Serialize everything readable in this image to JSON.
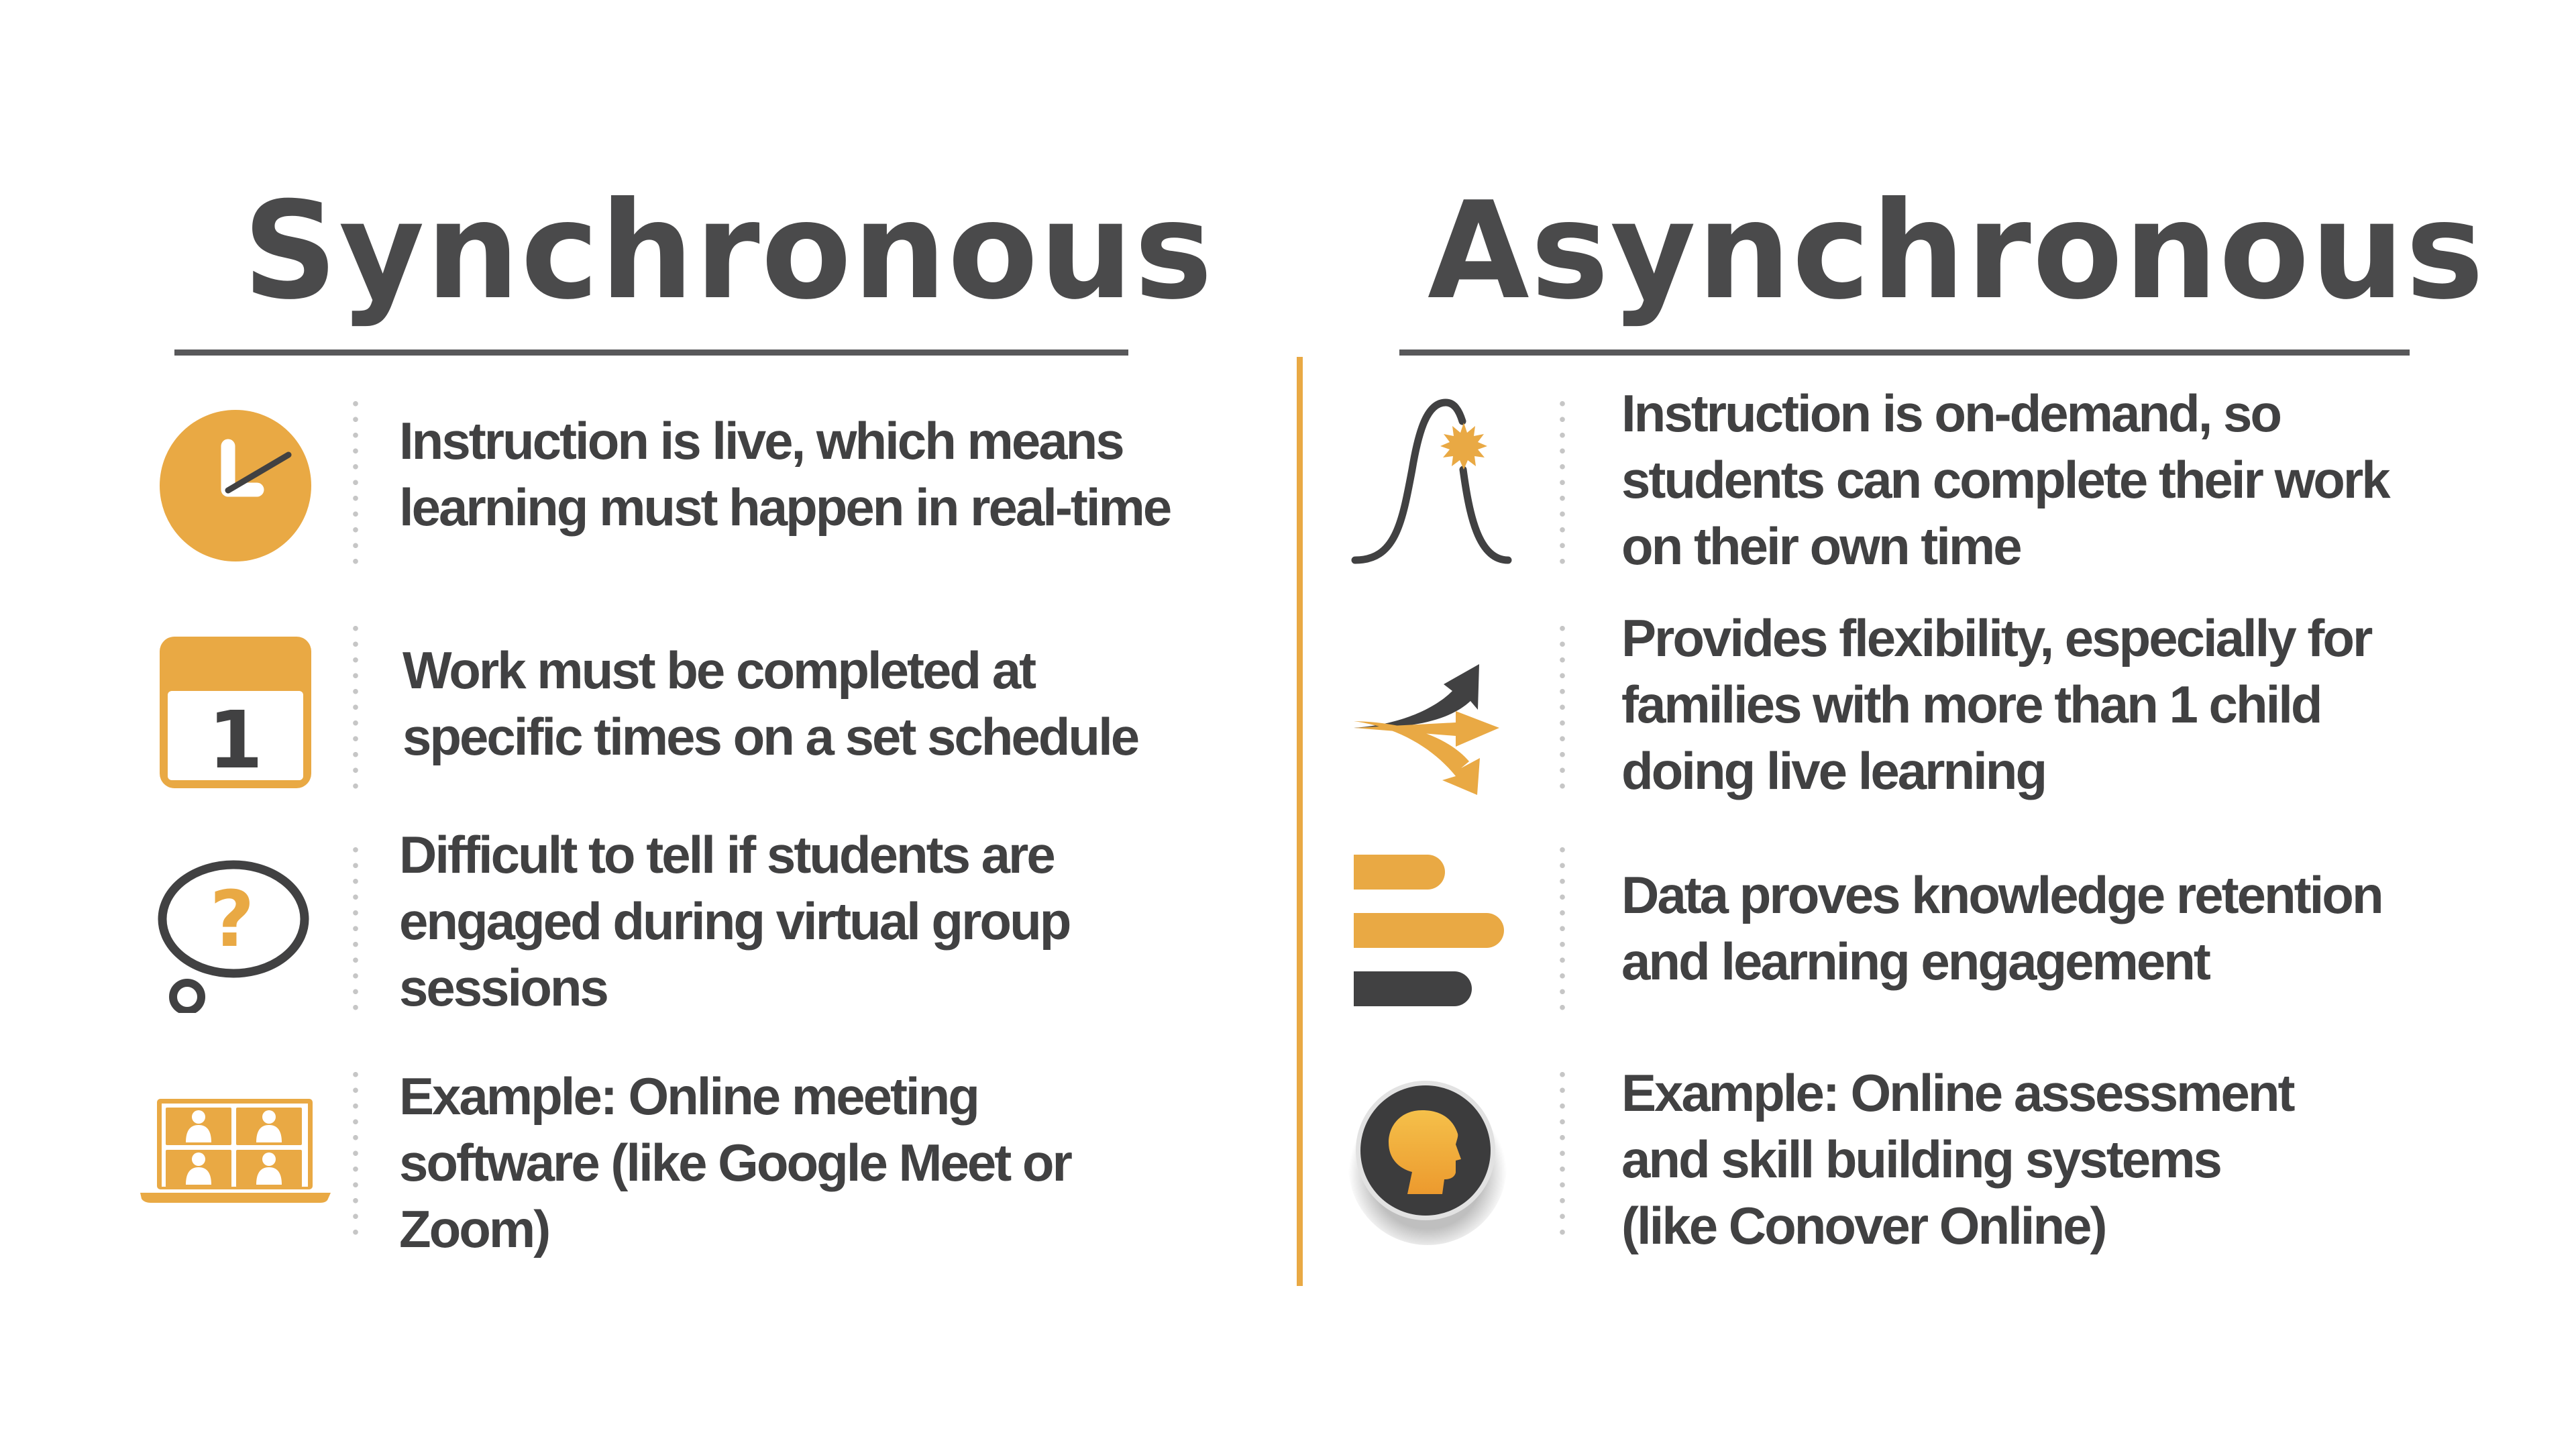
{
  "colors": {
    "accent": "#e9a944",
    "dark": "#414142",
    "heading": "#4a4a4b",
    "rule": "#58585a",
    "dots": "#c6c6c6"
  },
  "synchronous": {
    "title": "Synchronous",
    "items": [
      {
        "icon": "clock-icon",
        "lines": [
          "Instruction is live, which means",
          "learning  must happen in real-time"
        ]
      },
      {
        "icon": "calendar-icon",
        "calendar_day": "1",
        "lines": [
          "Work must be completed at",
          "specific times on a set schedule"
        ]
      },
      {
        "icon": "thought-bubble-question-icon",
        "symbol": "?",
        "lines": [
          "Difficult to tell  if students are",
          "engaged during virtual group",
          "sessions"
        ]
      },
      {
        "icon": "video-conference-laptop-icon",
        "lines": [
          "Example:  Online meeting",
          "software (like Google Meet or",
          "Zoom)"
        ]
      }
    ]
  },
  "asynchronous": {
    "title": "Asynchronous",
    "items": [
      {
        "icon": "bell-curve-burst-icon",
        "lines": [
          "Instruction  is on-demand, so",
          "students can complete their work",
          "on their own time"
        ]
      },
      {
        "icon": "diverging-arrows-icon",
        "lines": [
          "Provides flexibility, especially for",
          "families with more than 1 child",
          "doing live learning"
        ]
      },
      {
        "icon": "bar-data-icon",
        "lines": [
          "Data proves knowledge retention",
          "and learning engagement"
        ]
      },
      {
        "icon": "head-profile-badge-icon",
        "lines": [
          "Example: Online assessment",
          "and skill building  systems",
          "(like Conover Online)"
        ]
      }
    ]
  }
}
